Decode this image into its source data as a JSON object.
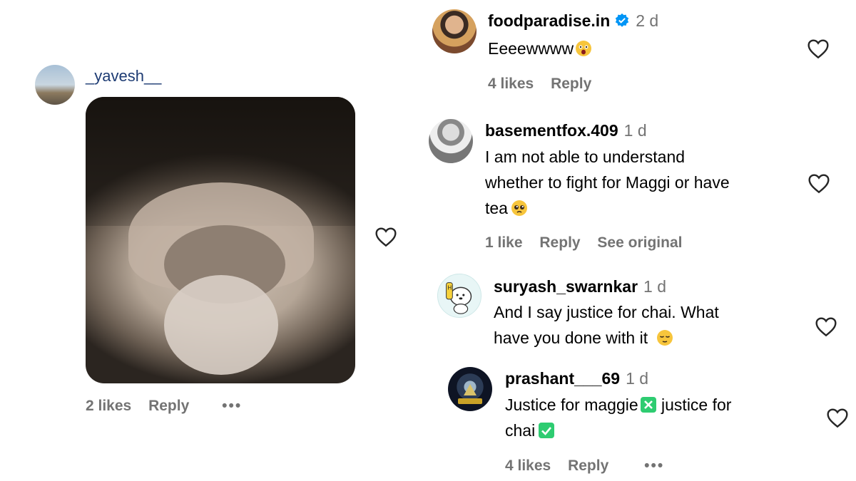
{
  "left_comment": {
    "username": "_yavesh__",
    "likes": "2 likes",
    "reply": "Reply",
    "more": "•••",
    "media": "gif-image"
  },
  "comments": [
    {
      "username": "foodparadise.in",
      "verified": true,
      "time": "2 d",
      "text": "Eeeewwww",
      "emoji": "astonished-face-emoji",
      "likes": "4 likes",
      "reply": "Reply"
    },
    {
      "username": "basementfox.409",
      "time": "1 d",
      "text_lines": [
        "I am not able to understand",
        "whether to fight for Maggi or have",
        "tea"
      ],
      "emoji": "pleading-face-emoji",
      "likes": "1 like",
      "reply": "Reply",
      "see_original": "See original"
    },
    {
      "username": "suryash_swarnkar",
      "time": "1 d",
      "text_lines": [
        "And I say justice for chai. What",
        "have you done with it"
      ],
      "emoji": "relieved-face-emoji",
      "likes": "",
      "reply": ""
    },
    {
      "username": "prashant___69",
      "time": "1 d",
      "text_line1_a": "Justice for maggie",
      "text_line1_b": " justice for",
      "text_line2": "chai",
      "emoji_1": "cross-mark-button-emoji",
      "emoji_2": "check-mark-button-emoji",
      "likes": "4 likes",
      "reply": "Reply",
      "more": "•••"
    }
  ],
  "colors": {
    "text": "#000000",
    "secondary": "#737373",
    "verified_blue": "#0095f6",
    "check_green": "#2ecc71"
  },
  "icons": [
    "heart-icon",
    "verified-badge-icon",
    "more-options-icon"
  ]
}
